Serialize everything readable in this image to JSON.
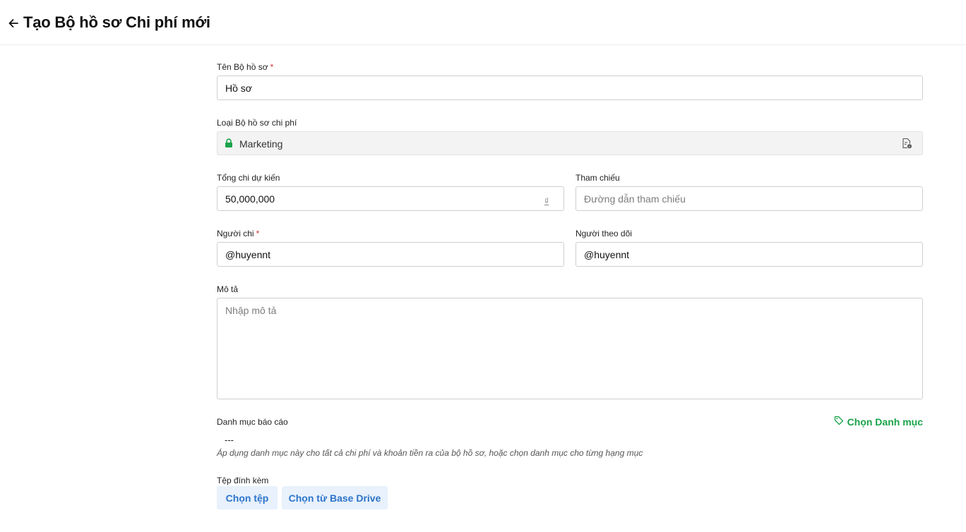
{
  "header": {
    "title": "Tạo Bộ hồ sơ Chi phí mới"
  },
  "form": {
    "name": {
      "label": "Tên Bộ hồ sơ",
      "required_mark": "*",
      "value": "Hồ sơ"
    },
    "type": {
      "label": "Loại Bộ hồ sơ chi phí",
      "value": "Marketing"
    },
    "total": {
      "label": "Tổng chi dự kiến",
      "value": "50,000,000",
      "currency": "₫"
    },
    "reference": {
      "label": "Tham chiếu",
      "placeholder": "Đường dẫn tham chiếu"
    },
    "payer": {
      "label": "Người chi",
      "required_mark": "*",
      "value": "@huyennt"
    },
    "follower": {
      "label": "Người theo dõi",
      "value": "@huyennt"
    },
    "description": {
      "label": "Mô tả",
      "placeholder": "Nhập mô tả"
    },
    "category": {
      "label": "Danh mục báo cáo",
      "button": "Chọn Danh mục",
      "value": "---",
      "hint": "Áp dụng danh mục này cho tất cả chi phí và khoản tiền ra của bộ hồ sơ, hoặc chọn danh mục cho từng hạng mục"
    },
    "attachments": {
      "label": "Tệp đính kèm",
      "choose_file": "Chọn tệp",
      "choose_drive": "Chọn từ Base Drive"
    }
  },
  "icons": {
    "back": "arrow-left-icon",
    "lock": "lock-icon",
    "doc": "document-info-icon",
    "tag": "tag-icon"
  },
  "colors": {
    "accent_green": "#1aa34a",
    "link_blue": "#2d74c9",
    "button_bg": "#e8f1fc",
    "required_red": "#d32f2f"
  }
}
